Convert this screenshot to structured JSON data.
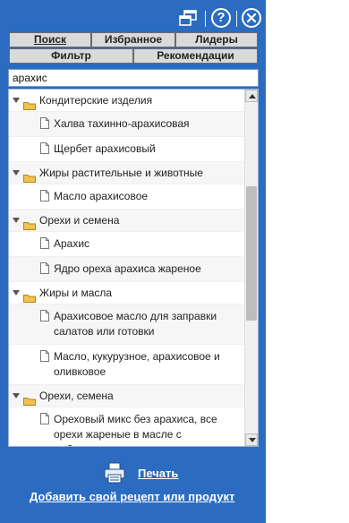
{
  "tabs": {
    "search": "Поиск",
    "favorites": "Избранное",
    "leaders": "Лидеры",
    "filter": "Фильтр",
    "recommendations": "Рекомендации"
  },
  "search": {
    "value": "арахис"
  },
  "tree": [
    {
      "category": "Кондитерские изделия",
      "items": [
        "Халва тахинно-арахисовая",
        "Щербет арахисовый"
      ]
    },
    {
      "category": "Жиры растительные и животные",
      "items": [
        "Масло арахисовое"
      ]
    },
    {
      "category": "Орехи и семена",
      "items": [
        "Арахис",
        "Ядро ореха арахиса жареное"
      ]
    },
    {
      "category": "Жиры и масла",
      "items": [
        "Арахисовое масло для заправки салатов или готовки",
        "Масло, кукурузное, арахисовое и оливковое"
      ]
    },
    {
      "category": "Орехи, семена",
      "items": [
        "Ореховый микс без арахиса, все орехи жареные в масле с добавлением соли"
      ]
    }
  ],
  "footer": {
    "print": "Печать",
    "add": "Добавить свой рецепт или продукт"
  },
  "icons": {
    "window": "restore-window-icon",
    "help": "help-icon",
    "close": "close-icon",
    "folder": "folder-icon",
    "document": "document-icon",
    "printer": "printer-icon"
  },
  "colors": {
    "panel": "#2b6cc0",
    "tab": "#dadada",
    "folder": "#f2c14e"
  }
}
